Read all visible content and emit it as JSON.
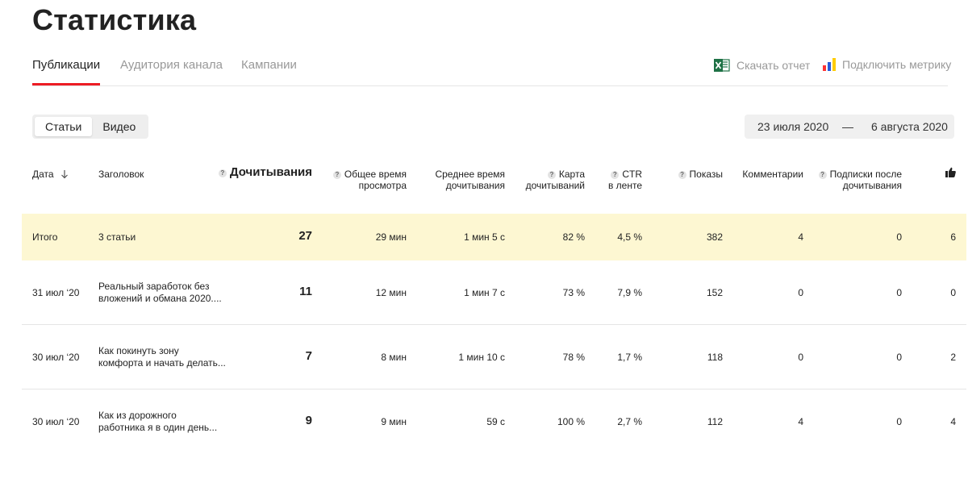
{
  "page": {
    "title": "Статистика"
  },
  "tabs": [
    {
      "label": "Публикации",
      "active": true
    },
    {
      "label": "Аудитория канала",
      "active": false
    },
    {
      "label": "Кампании",
      "active": false
    }
  ],
  "actions": {
    "download": "Скачать отчет",
    "metrika": "Подключить метрику"
  },
  "content_type": {
    "articles": "Статьи",
    "video": "Видео",
    "selected": "Статьи"
  },
  "date_range": {
    "from": "23 июля 2020",
    "separator": "—",
    "to": "6 августа 2020"
  },
  "columns": {
    "date": "Дата",
    "headline": "Заголовок",
    "reads": "Дочитывания",
    "total_time_1": "Общее время",
    "total_time_2": "просмотра",
    "avg_time_1": "Среднее время",
    "avg_time_2": "дочитывания",
    "read_card_1": "Карта",
    "read_card_2": "дочитываний",
    "ctr_1": "CTR",
    "ctr_2": "в ленте",
    "views": "Показы",
    "comments": "Комментарии",
    "subs_1": "Подписки после",
    "subs_2": "дочитывания"
  },
  "rows": [
    {
      "date": "Итого",
      "title_1": "3 статьи",
      "title_2": "",
      "reads": "27",
      "total_time": "29 мин",
      "avg_time": "1 мин 5 с",
      "read_card": "82 %",
      "ctr": "4,5 %",
      "views": "382",
      "comments": "4",
      "subs": "0",
      "likes": "6"
    },
    {
      "date": "31 июл ‘20",
      "title_1": "Реальный заработок без",
      "title_2": "вложений и обмана 2020....",
      "reads": "11",
      "total_time": "12 мин",
      "avg_time": "1 мин 7 с",
      "read_card": "73 %",
      "ctr": "7,9 %",
      "views": "152",
      "comments": "0",
      "subs": "0",
      "likes": "0"
    },
    {
      "date": "30 июл ‘20",
      "title_1": "Как покинуть зону",
      "title_2": "комфорта и начать делать...",
      "reads": "7",
      "total_time": "8 мин",
      "avg_time": "1 мин 10 с",
      "read_card": "78 %",
      "ctr": "1,7 %",
      "views": "118",
      "comments": "0",
      "subs": "0",
      "likes": "2"
    },
    {
      "date": "30 июл ‘20",
      "title_1": "Как из дорожного",
      "title_2": "работника я в один день...",
      "reads": "9",
      "total_time": "9 мин",
      "avg_time": "59 с",
      "read_card": "100 %",
      "ctr": "2,7 %",
      "views": "112",
      "comments": "4",
      "subs": "0",
      "likes": "4"
    }
  ],
  "icons": {
    "sort": "arrow-down-icon",
    "help": "question-icon",
    "likes": "thumbs-up-icon",
    "excel": "excel-icon",
    "metrika": "metrika-icon"
  },
  "colors": {
    "accent": "#ed1c24",
    "total_row": "#fdf7d2",
    "excel": "#1e7145"
  }
}
